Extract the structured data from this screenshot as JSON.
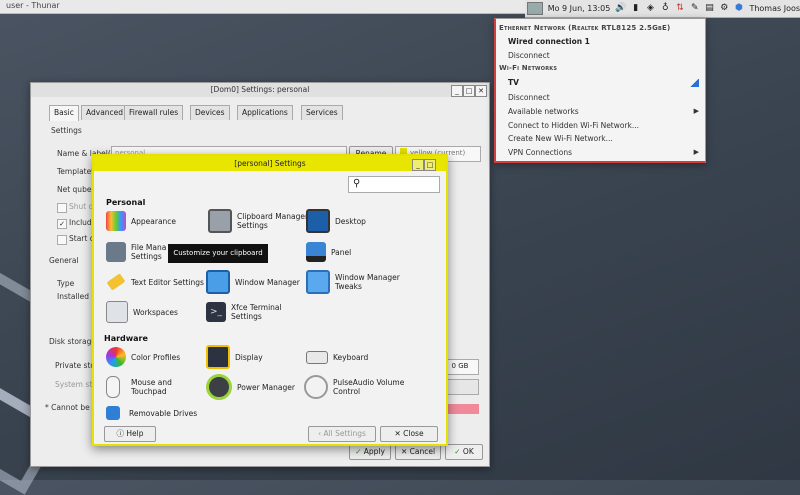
{
  "taskbar": {
    "thunar_title": "user - Thunar"
  },
  "panel": {
    "clock": "Mo 9 Jun, 13:05",
    "user": "Thomas Joos"
  },
  "network_menu": {
    "ethernet_header": "Ethernet Network (Realtek RTL8125 2.5GbE)",
    "wired_connection": "Wired connection 1",
    "disconnect": "Disconnect",
    "wifi_header": "Wi-Fi Networks",
    "wifi_network": "TV",
    "wifi_disconnect": "Disconnect",
    "available_networks": "Available networks",
    "connect_hidden": "Connect to Hidden Wi-Fi Network...",
    "create_new": "Create New Wi-Fi Network...",
    "vpn": "VPN Connections",
    "signal_color": "#2a6fd6"
  },
  "qube_window": {
    "title": "[Dom0] Settings: personal",
    "tabs": [
      "Basic",
      "Advanced",
      "Firewall rules",
      "Devices",
      "Applications",
      "Services"
    ],
    "settings_label": "Settings",
    "name_label": "Name & label(*):",
    "name_value": "personal",
    "rename_button": "Rename",
    "label_value": "yellow (current)",
    "template_label": "Template*:",
    "netqube_label": "Net qube:",
    "shutdown_label": "Shut do",
    "include_label": "Include",
    "start_label": "Start qu",
    "general_label": "General",
    "type_label": "Type",
    "installed_label": "Installed by",
    "disk_label": "Disk storage",
    "private_label": "Private stor",
    "system_label": "System stor",
    "size_value": "0 GB",
    "note": "* Cannot be c",
    "apply_button": "Apply",
    "cancel_button": "Cancel",
    "ok_button": "OK"
  },
  "settings_window": {
    "title": "[personal] Settings",
    "personal_section": "Personal",
    "hardware_section": "Hardware",
    "personal_items": [
      {
        "label": "Appearance",
        "icon": "appearance-icon"
      },
      {
        "label": "Clipboard Manager\nSettings",
        "icon": "clipboard-icon"
      },
      {
        "label": "Desktop",
        "icon": "desktop-icon"
      },
      {
        "label": "File Mana\nSettings",
        "icon": "file-manager-icon"
      },
      {
        "label": "Panel",
        "icon": "panel-icon"
      },
      {
        "label": "Text Editor Settings",
        "icon": "text-editor-icon"
      },
      {
        "label": "Window Manager",
        "icon": "window-manager-icon"
      },
      {
        "label": "Window Manager\nTweaks",
        "icon": "wm-tweaks-icon"
      },
      {
        "label": "Workspaces",
        "icon": "workspaces-icon"
      },
      {
        "label": "Xfce Terminal\nSettings",
        "icon": "terminal-icon"
      }
    ],
    "hardware_items": [
      {
        "label": "Color Profiles",
        "icon": "color-profiles-icon"
      },
      {
        "label": "Display",
        "icon": "display-icon"
      },
      {
        "label": "Keyboard",
        "icon": "keyboard-icon"
      },
      {
        "label": "Mouse and\nTouchpad",
        "icon": "mouse-icon"
      },
      {
        "label": "Power Manager",
        "icon": "power-icon"
      },
      {
        "label": "PulseAudio Volume\nControl",
        "icon": "pulseaudio-icon"
      },
      {
        "label": "Removable Drives",
        "icon": "removable-drives-icon"
      }
    ],
    "tooltip": "Customize your clipboard",
    "help_button": "Help",
    "all_settings_button": "All Settings",
    "close_button": "Close"
  }
}
